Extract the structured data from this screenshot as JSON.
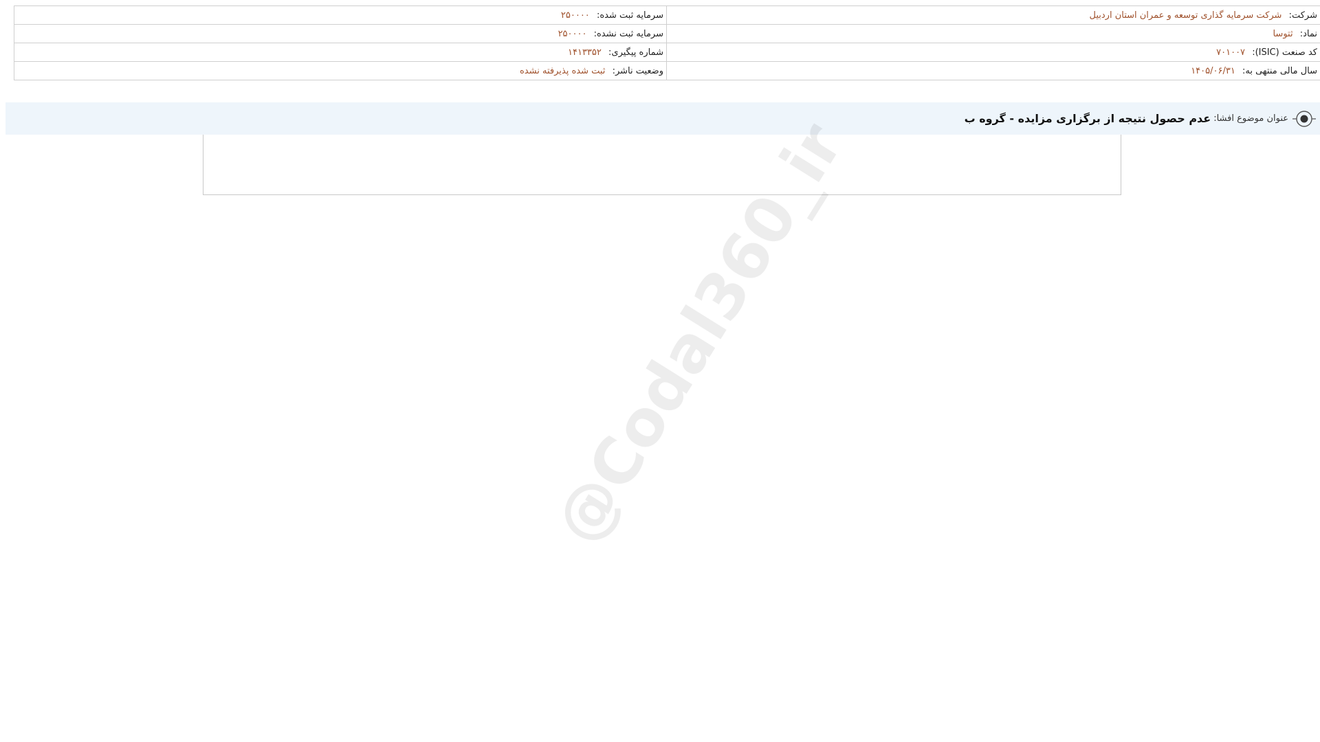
{
  "company": {
    "label": "شرکت:",
    "value": "شرکت سرمایه گذاری توسعه و عمران استان اردبیل"
  },
  "registered_capital": {
    "label": "سرمایه ثبت شده:",
    "value": "۲۵۰۰۰۰"
  },
  "symbol": {
    "label": "نماد:",
    "value": "ثتوسا"
  },
  "unregistered_capital": {
    "label": "سرمایه ثبت نشده:",
    "value": "۲۵۰۰۰۰"
  },
  "isic": {
    "label": "کد صنعت (ISIC):",
    "value": "۷۰۱۰۰۷"
  },
  "tracking_number": {
    "label": "شماره پیگیری:",
    "value": "۱۴۱۳۳۵۲"
  },
  "fiscal_year": {
    "label": "سال مالی منتهی به:",
    "value": "۱۴۰۵/۰۶/۳۱"
  },
  "publisher_status": {
    "label": "وضعیت ناشر:",
    "value": "ثبت شده پذیرفته نشده"
  },
  "topic": {
    "label": "عنوان موضوع افشا:",
    "title": "عدم حصول نتیجه از برگزاری مزایده - گروه ب",
    "icon": "target-icon"
  },
  "watermark": {
    "text": "@Codal360_ir"
  },
  "colors": {
    "value_text": "#a0522d",
    "topic_bar_bg": "#eef5fb",
    "border": "#cfcfcf"
  }
}
